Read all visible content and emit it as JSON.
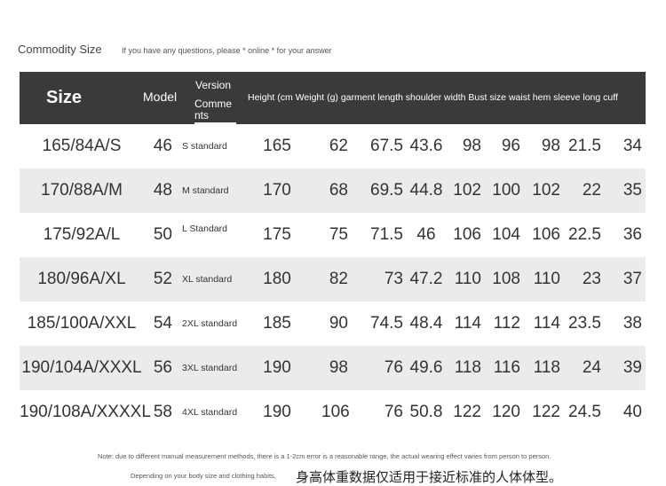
{
  "title": "Commodity Size",
  "subtitle": "If you have any questions, please * online * for your answer",
  "table": {
    "headers": {
      "size": "Size",
      "model": "Model",
      "version": "Version",
      "comments": "Comments",
      "rest": "Height (cm Weight (g) garment length shoulder width Bust size waist hem sleeve long cuff"
    },
    "rows": [
      {
        "size": "165/84A/S",
        "model": "46",
        "version": "S standard",
        "height": "165",
        "weight": "62",
        "length": "67.5",
        "shoulder": "43.6",
        "bust": "98",
        "waist": "96",
        "hem": "98",
        "sleeve": "21.5",
        "cuff": "34"
      },
      {
        "size": "170/88A/M",
        "model": "48",
        "version": "M standard",
        "height": "170",
        "weight": "68",
        "length": "69.5",
        "shoulder": "44.8",
        "bust": "102",
        "waist": "100",
        "hem": "102",
        "sleeve": "22",
        "cuff": "35"
      },
      {
        "size": "175/92A/L",
        "model": "50",
        "version": "L Standard",
        "height": "175",
        "weight": "75",
        "length": "71.5",
        "shoulder": "46",
        "bust": "106",
        "waist": "104",
        "hem": "106",
        "sleeve": "22.5",
        "cuff": "36"
      },
      {
        "size": "180/96A/XL",
        "model": "52",
        "version": "XL standard",
        "height": "180",
        "weight": "82",
        "length": "73",
        "shoulder": "47.2",
        "bust": "110",
        "waist": "108",
        "hem": "110",
        "sleeve": "23",
        "cuff": "37"
      },
      {
        "size": "185/100A/XXL",
        "model": "54",
        "version": "2XL standard",
        "height": "185",
        "weight": "90",
        "length": "74.5",
        "shoulder": "48.4",
        "bust": "114",
        "waist": "112",
        "hem": "114",
        "sleeve": "23.5",
        "cuff": "38"
      },
      {
        "size": "190/104A/XXXL",
        "model": "56",
        "version": "3XL standard",
        "height": "190",
        "weight": "98",
        "length": "76",
        "shoulder": "49.6",
        "bust": "118",
        "waist": "116",
        "hem": "118",
        "sleeve": "24",
        "cuff": "39"
      },
      {
        "size": "190/108A/XXXXL",
        "model": "58",
        "version": "4XL standard",
        "height": "190",
        "weight": "106",
        "length": "76",
        "shoulder": "50.8",
        "bust": "122",
        "waist": "120",
        "hem": "122",
        "sleeve": "24.5",
        "cuff": "40"
      }
    ]
  },
  "note": "Note: due to different manual measurement methods, there is a 1-2cm error is a reasonable range, the actual wearing effect varies from person to person.",
  "depending": "Depending on your body size and clothing habits,",
  "cn_note": "身高体重数据仅适用于接近标准的人体体型。",
  "colors": {
    "header_bg": "#3a3a3a",
    "row_shade": "#ebebeb"
  }
}
